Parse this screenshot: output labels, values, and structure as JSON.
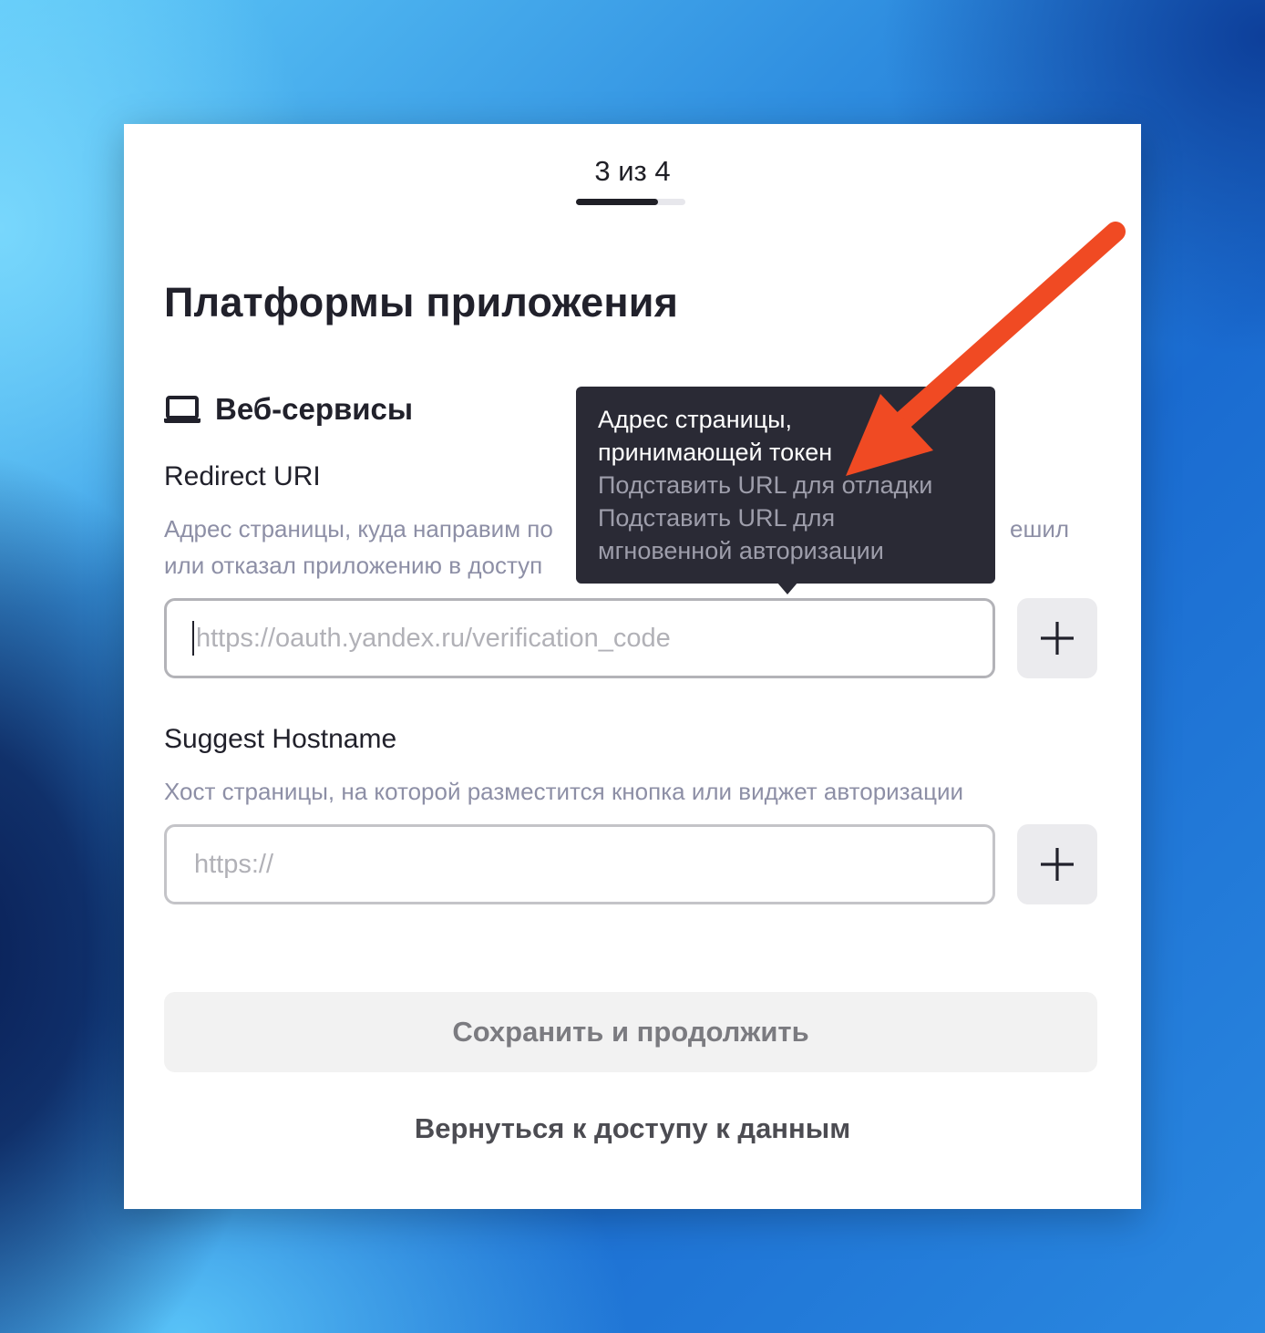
{
  "wizard": {
    "step_text": "3 из 4",
    "progress": 0.75
  },
  "page": {
    "title": "Платформы приложения"
  },
  "section": {
    "icon": "laptop-icon",
    "title": "Веб-сервисы"
  },
  "redirect_uri": {
    "label": "Redirect URI",
    "hint_line1": "Адрес страницы, куда направим по",
    "hint_line1_end": "ешил",
    "hint_line2": "или отказал приложению в доступ",
    "placeholder": "https://oauth.yandex.ru/verification_code",
    "value": "",
    "add_icon": "plus-icon"
  },
  "suggest_hostname": {
    "label": "Suggest Hostname",
    "hint": "Хост страницы, на которой разместится кнопка или виджет авторизации",
    "placeholder": "https://",
    "value": "",
    "add_icon": "plus-icon"
  },
  "tooltip": {
    "line1": "Адрес страницы,",
    "line2": "принимающей токен",
    "option_debug": "Подставить URL для отладки",
    "option_instant_line1": "Подставить URL для",
    "option_instant_line2": "мгновенной авторизации"
  },
  "actions": {
    "save_label": "Сохранить и продолжить",
    "back_label": "Вернуться к доступу к данным"
  },
  "colors": {
    "annotation_arrow": "#f04a23",
    "tooltip_bg": "#2a2a35",
    "hint_text": "#8d8fa6"
  }
}
